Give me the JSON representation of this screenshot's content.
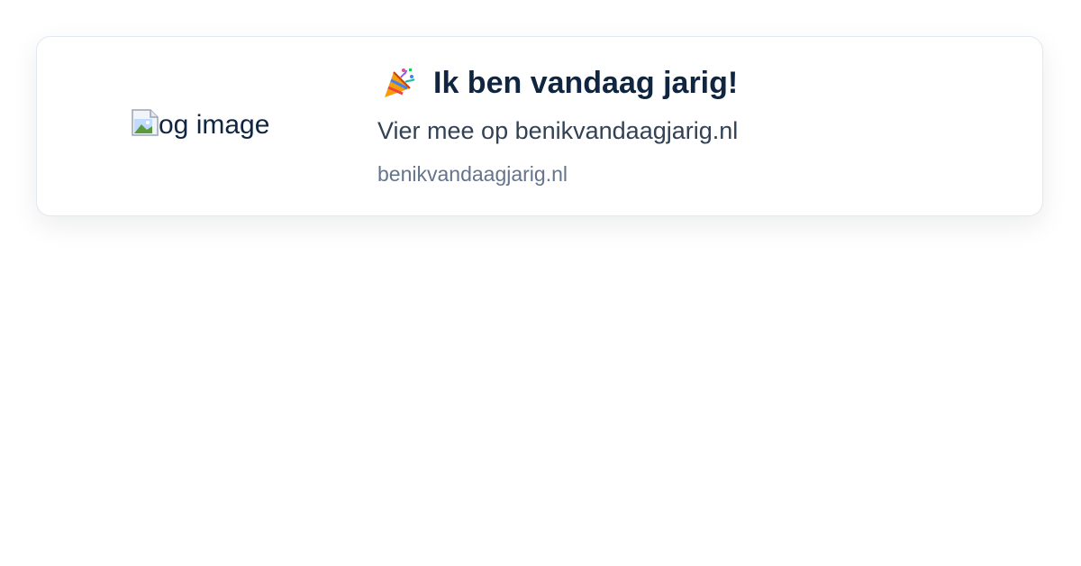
{
  "preview_card": {
    "image": {
      "alt": "og image",
      "icon": "broken-image-icon"
    },
    "title_icon": "party-popper-icon",
    "title": "Ik ben vandaag jarig!",
    "description": "Vier mee op benikvandaagjarig.nl",
    "domain": "benikvandaagjarig.nl"
  },
  "colors": {
    "title": "#0f2540",
    "description": "#334155",
    "domain": "#64748b",
    "card_border": "#e2e8f0"
  }
}
